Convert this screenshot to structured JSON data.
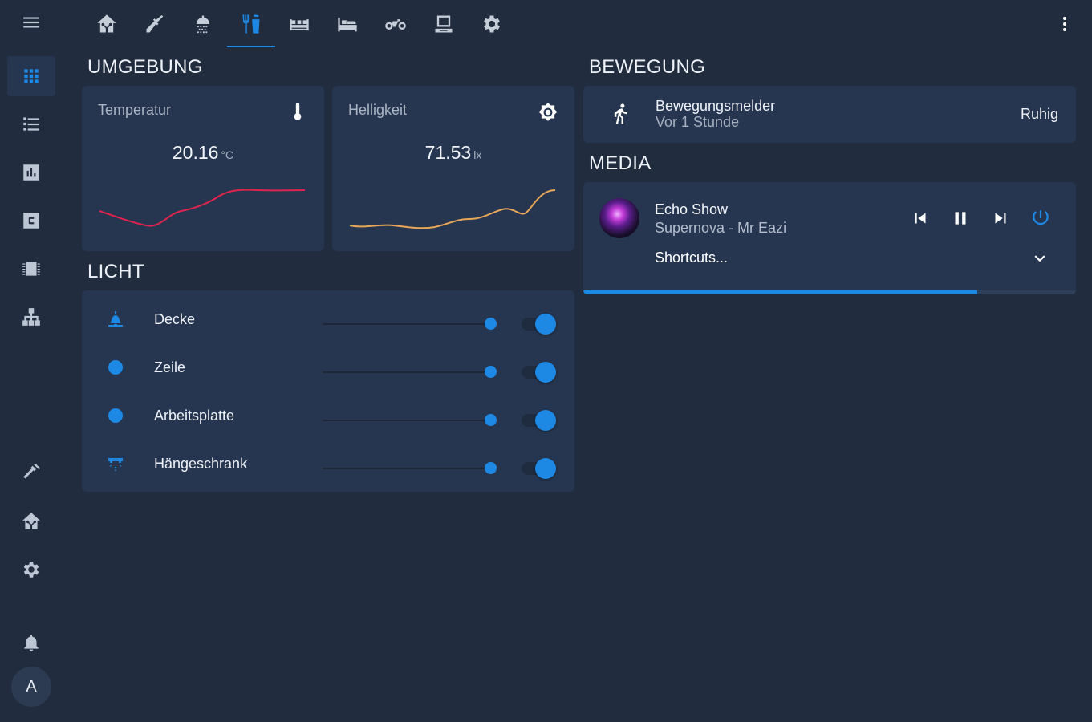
{
  "sidebar": {
    "items": [
      {
        "icon": "menu-icon"
      },
      {
        "icon": "dashboard-grid-icon",
        "active": true
      },
      {
        "icon": "list-icon"
      },
      {
        "icon": "bar-chart-icon"
      },
      {
        "icon": "c-badge-icon"
      },
      {
        "icon": "chip-icon"
      },
      {
        "icon": "sitemap-icon"
      },
      {
        "icon": "hammer-icon"
      },
      {
        "icon": "home-assistant-icon"
      },
      {
        "icon": "gear-icon"
      },
      {
        "icon": "bell-icon"
      }
    ],
    "avatar_initial": "A"
  },
  "tabs": [
    {
      "icon": "home-icon"
    },
    {
      "icon": "broom-icon"
    },
    {
      "icon": "shower-icon"
    },
    {
      "icon": "fork-knife-icon",
      "active": true
    },
    {
      "icon": "sofa-icon"
    },
    {
      "icon": "bed-icon"
    },
    {
      "icon": "bicycle-icon"
    },
    {
      "icon": "desktop-icon"
    },
    {
      "icon": "gear-icon"
    }
  ],
  "sections": {
    "umgebung": "UMGEBUNG",
    "licht": "LICHT",
    "bewegung": "BEWEGUNG",
    "media": "MEDIA"
  },
  "sensors": {
    "temperature": {
      "name": "Temperatur",
      "value": "20.16",
      "unit": "°C",
      "line_color": "#e0234e"
    },
    "brightness": {
      "name": "Helligkeit",
      "value": "71.53",
      "unit": "lx",
      "line_color": "#e8a657"
    }
  },
  "lights": [
    {
      "name": "Decke",
      "icon": "ceiling-light-icon",
      "on": true,
      "brightness": 1.0
    },
    {
      "name": "Zeile",
      "icon": "bulb-dot-icon",
      "on": true,
      "brightness": 1.0
    },
    {
      "name": "Arbeitsplatte",
      "icon": "bulb-dot-icon",
      "on": true,
      "brightness": 1.0
    },
    {
      "name": "Hängeschrank",
      "icon": "cabinet-light-icon",
      "on": true,
      "brightness": 1.0
    }
  ],
  "motion": {
    "name": "Bewegungsmelder",
    "last_changed": "Vor 1 Stunde",
    "state": "Ruhig"
  },
  "media": {
    "player": "Echo Show",
    "track": "Supernova - Mr Eazi",
    "shortcuts_label": "Shortcuts...",
    "progress": 0.8
  },
  "colors": {
    "background": "#212c3e",
    "card": "#263650",
    "accent": "#1e88e5"
  }
}
